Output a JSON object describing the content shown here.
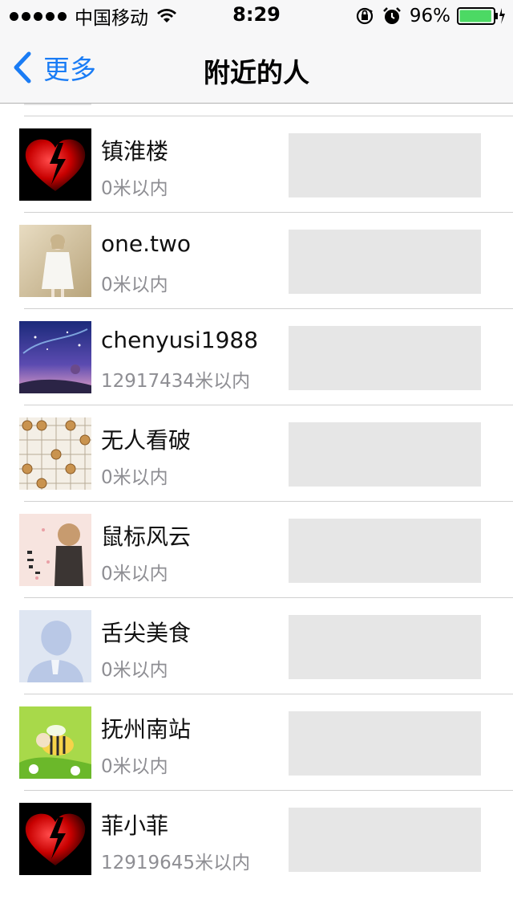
{
  "status_bar": {
    "carrier": "中国移动",
    "time": "8:29",
    "battery_percent": "96%",
    "battery_level": 0.96,
    "icons": [
      "signal-dots",
      "wifi-icon",
      "rotation-lock-icon",
      "alarm-icon",
      "battery-icon",
      "charging-bolt-icon"
    ]
  },
  "nav": {
    "back_label": "更多",
    "title": "附近的人"
  },
  "colors": {
    "accent": "#1a7cf5",
    "battery_green": "#4cd964",
    "secondary_text": "#8e8e93",
    "placeholder": "#e6e6e6"
  },
  "people": [
    {
      "name": "镇淮楼",
      "distance": "0米以内",
      "avatar": "broken-heart"
    },
    {
      "name": "one.two",
      "distance": "0米以内",
      "avatar": "photo-girl"
    },
    {
      "name": "chenyusi1988",
      "distance": "12917434米以内",
      "avatar": "night-sky"
    },
    {
      "name": "无人看破",
      "distance": "0米以内",
      "avatar": "chess-board"
    },
    {
      "name": "鼠标风云",
      "distance": "0米以内",
      "avatar": "illustration-girl"
    },
    {
      "name": "舌尖美食",
      "distance": "0米以内",
      "avatar": "default-person"
    },
    {
      "name": "抚州南站",
      "distance": "0米以内",
      "avatar": "cartoon-bee"
    },
    {
      "name": "菲小菲",
      "distance": "12919645米以内",
      "avatar": "broken-heart"
    }
  ]
}
